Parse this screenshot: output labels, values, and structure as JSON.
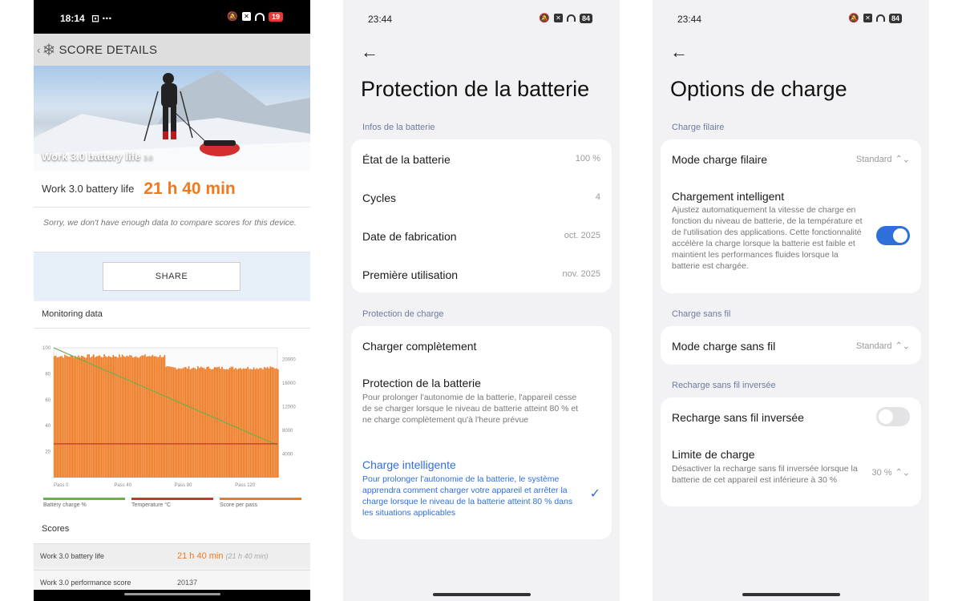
{
  "p1": {
    "status": {
      "time": "18:14",
      "extra": "⊡ ⋯",
      "battery": "19"
    },
    "header": {
      "title": "SCORE DETAILS"
    },
    "hero": {
      "title": "Work 3.0 battery life",
      "version": "3.0"
    },
    "result": {
      "label": "Work 3.0 battery life",
      "value": "21 h 40 min"
    },
    "note": "Sorry, we don't have enough data to compare scores for this device.",
    "share_label": "SHARE",
    "monitoring_title": "Monitoring data",
    "legend": [
      {
        "label": "Battery charge %",
        "color": "#6ab04c"
      },
      {
        "label": "Temperature °C",
        "color": "#c0392b"
      },
      {
        "label": "Score per pass",
        "color": "#f0781e"
      }
    ],
    "scores_title": "Scores",
    "scores": [
      {
        "name": "Work 3.0 battery life",
        "value": "21 h 40 min",
        "sub": "(21 h 40 min)"
      },
      {
        "name": "Work 3.0 performance score",
        "value": "20137",
        "sub": ""
      }
    ]
  },
  "chart_data": {
    "type": "bar",
    "title": "",
    "xlabel": "",
    "ylabel": "",
    "x_ticks": [
      "Pass 0",
      "Pass 40",
      "Pass 80",
      "Pass 120"
    ],
    "y_left_ticks": [
      20,
      40,
      60,
      80,
      100
    ],
    "y_right_ticks": [
      4000,
      8000,
      12000,
      16000,
      20000
    ],
    "ylim_left": [
      0,
      100
    ],
    "ylim_right": [
      0,
      22000
    ],
    "series": [
      {
        "name": "Score per pass",
        "type": "bar",
        "axis": "right",
        "color": "#f0781e",
        "segments": [
          {
            "from_pass": 0,
            "to_pass": 73,
            "value": 20600
          },
          {
            "from_pass": 74,
            "to_pass": 148,
            "value": 18600
          }
        ]
      },
      {
        "name": "Battery charge %",
        "type": "line",
        "axis": "left",
        "color": "#6ab04c",
        "points": [
          [
            0,
            100
          ],
          [
            148,
            25
          ]
        ]
      },
      {
        "name": "Temperature °C",
        "type": "line",
        "axis": "left",
        "color": "#c0392b",
        "points": [
          [
            0,
            26
          ],
          [
            148,
            26
          ]
        ]
      }
    ],
    "legend_position": "bottom",
    "grid": false
  },
  "p2": {
    "status": {
      "time": "23:44",
      "battery": "84"
    },
    "title": "Protection de la batterie",
    "sections": [
      {
        "title": "Infos de la batterie"
      },
      {
        "title": "Protection de charge"
      }
    ],
    "info_rows": [
      {
        "label": "État de la batterie",
        "value": "100 %"
      },
      {
        "label": "Cycles",
        "value": "4"
      },
      {
        "label": "Date de fabrication",
        "value": "oct. 2025"
      },
      {
        "label": "Première utilisation",
        "value": "nov. 2025"
      }
    ],
    "charge_rows": [
      {
        "label": "Charger complètement",
        "desc": ""
      },
      {
        "label": "Protection de la batterie",
        "desc": "Pour prolonger l'autonomie de la batterie, l'appareil cesse de se charger lorsque le niveau de batterie atteint 80 % et ne charge complètement qu'à l'heure prévue"
      },
      {
        "label": "Charge intelligente",
        "desc": "Pour prolonger l'autonomie de la batterie, le système apprendra comment charger votre appareil et arrêter la charge lorsque le niveau de la batterie atteint 80 % dans les situations applicables",
        "selected": true
      }
    ]
  },
  "p3": {
    "status": {
      "time": "23:44",
      "battery": "84"
    },
    "title": "Options de charge",
    "sec_wired": "Charge filaire",
    "wired_mode": {
      "label": "Mode charge filaire",
      "value": "Standard"
    },
    "smart_charge": {
      "label": "Chargement intelligent",
      "desc": "Ajustez automatiquement la vitesse de charge en fonction du niveau de batterie, de la température et de l'utilisation des applications. Cette fonctionnalité accélère la charge lorsque la batterie est faible et maintient les performances fluides lorsque la batterie est chargée.",
      "enabled": true
    },
    "sec_wireless": "Charge sans fil",
    "wireless_mode": {
      "label": "Mode charge sans fil",
      "value": "Standard"
    },
    "sec_reverse": "Recharge sans fil inversée",
    "reverse": {
      "label": "Recharge sans fil inversée",
      "enabled": false
    },
    "limit": {
      "label": "Limite de charge",
      "desc": "Désactiver la recharge sans fil inversée lorsque la batterie de cet appareil est inférieure à 30 %",
      "value": "30 %"
    }
  },
  "colors": {
    "accent_blue": "#2f6fd9",
    "pcmark_orange": "#f0781e"
  }
}
